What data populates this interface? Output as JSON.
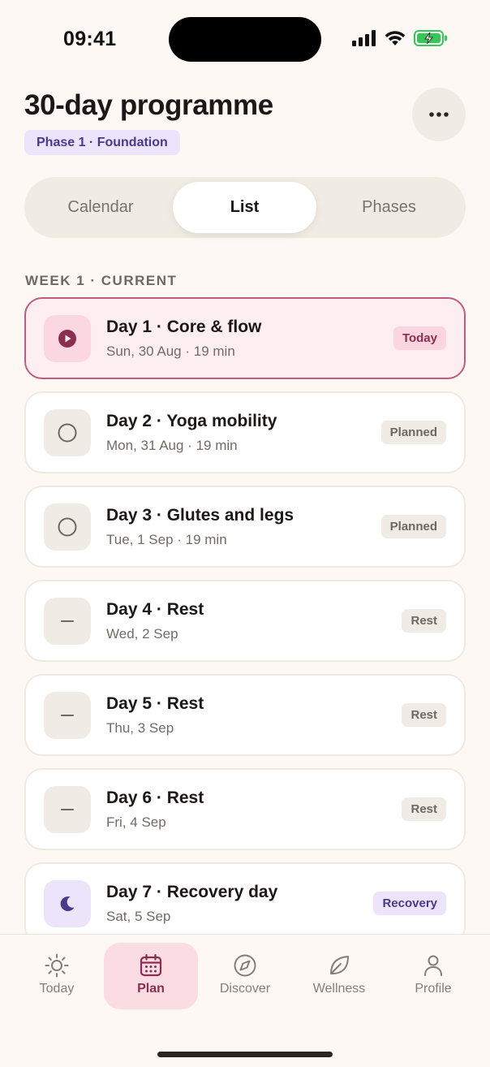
{
  "status_bar": {
    "time": "09:41"
  },
  "header": {
    "title": "30-day programme",
    "phase_badge": "Phase 1 · Foundation"
  },
  "tabs": [
    {
      "label": "Calendar",
      "active": false
    },
    {
      "label": "List",
      "active": true
    },
    {
      "label": "Phases",
      "active": false
    }
  ],
  "section_label": "WEEK 1 · CURRENT",
  "days": [
    {
      "title": "Day 1 · Core & flow",
      "subtitle": "Sun, 30 Aug · 19 min",
      "badge": "Today",
      "state": "today",
      "icon": "play-icon"
    },
    {
      "title": "Day 2 · Yoga mobility",
      "subtitle": "Mon, 31 Aug · 19 min",
      "badge": "Planned",
      "state": "planned",
      "icon": "circle-icon"
    },
    {
      "title": "Day 3 · Glutes and legs",
      "subtitle": "Tue, 1 Sep · 19 min",
      "badge": "Planned",
      "state": "planned",
      "icon": "circle-icon"
    },
    {
      "title": "Day 4 · Rest",
      "subtitle": "Wed, 2 Sep",
      "badge": "Rest",
      "state": "rest",
      "icon": "dash-icon"
    },
    {
      "title": "Day 5 · Rest",
      "subtitle": "Thu, 3 Sep",
      "badge": "Rest",
      "state": "rest",
      "icon": "dash-icon"
    },
    {
      "title": "Day 6 · Rest",
      "subtitle": "Fri, 4 Sep",
      "badge": "Rest",
      "state": "rest",
      "icon": "dash-icon"
    },
    {
      "title": "Day 7 · Recovery day",
      "subtitle": "Sat, 5 Sep",
      "badge": "Recovery",
      "state": "recovery",
      "icon": "moon-icon"
    }
  ],
  "nav": [
    {
      "label": "Today",
      "icon": "sun-icon",
      "active": false
    },
    {
      "label": "Plan",
      "icon": "calendar-icon",
      "active": true
    },
    {
      "label": "Discover",
      "icon": "compass-icon",
      "active": false
    },
    {
      "label": "Wellness",
      "icon": "leaf-icon",
      "active": false
    },
    {
      "label": "Profile",
      "icon": "person-icon",
      "active": false
    }
  ],
  "colors": {
    "background": "#fdf8f4",
    "accent": "#8b2e4f",
    "accent_soft": "#fbdce3",
    "today_border": "#c25c7f",
    "phase_purple": "#4a3a8c",
    "phase_purple_soft": "#ebe4fb",
    "battery_green": "#34c759"
  }
}
